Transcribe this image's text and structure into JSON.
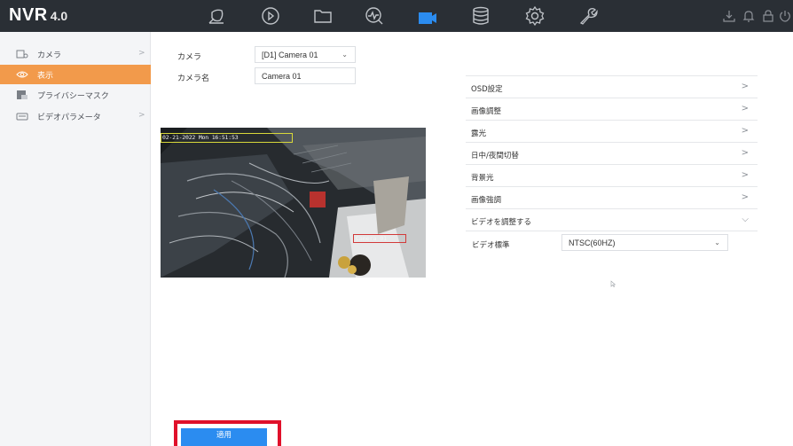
{
  "app": {
    "brand": "NVR",
    "version": "4.0"
  },
  "topnav": {
    "items": [
      {
        "name": "live-view",
        "icon": "live-view-icon"
      },
      {
        "name": "playback",
        "icon": "playback-icon"
      },
      {
        "name": "file-management",
        "icon": "folder-icon"
      },
      {
        "name": "smart-analysis",
        "icon": "analysis-icon"
      },
      {
        "name": "camera",
        "icon": "camera-icon",
        "active": true
      },
      {
        "name": "storage",
        "icon": "storage-icon"
      },
      {
        "name": "configuration",
        "icon": "gear-icon"
      },
      {
        "name": "maintenance",
        "icon": "wrench-icon"
      }
    ],
    "utilities": [
      "download-icon",
      "bell-icon",
      "lock-icon",
      "power-icon"
    ],
    "active_color": "#2b8cf0"
  },
  "sidebar": {
    "items": [
      {
        "label": "カメラ",
        "icon": "camera-icon",
        "has_children": true
      },
      {
        "label": "表示",
        "icon": "eye-icon",
        "active": true
      },
      {
        "label": "プライバシーマスク",
        "icon": "privacy-mask-icon"
      },
      {
        "label": "ビデオパラメータ",
        "icon": "video-parameter-icon",
        "has_children": true
      }
    ],
    "chevron": ">",
    "active_color": "#f29a4b"
  },
  "form": {
    "camera_label": "カメラ",
    "camera_value": "[D1] Camera 01",
    "camera_name_label": "カメラ名",
    "camera_name_value": "Camera 01"
  },
  "preview": {
    "osd_datetime": "02-21-2022 Mon 16:51:53",
    "osd_camera_name": "Camera 01"
  },
  "settings": {
    "rows": [
      {
        "label": "OSD設定",
        "chevron": ">"
      },
      {
        "label": "画像調整",
        "chevron": ">"
      },
      {
        "label": "露光",
        "chevron": ">"
      },
      {
        "label": "日中/夜間切替",
        "chevron": ">"
      },
      {
        "label": "背景光",
        "chevron": ">"
      },
      {
        "label": "画像強調",
        "chevron": ">"
      },
      {
        "label": "ビデオを調整する",
        "chevron": "⌵",
        "expanded": true
      }
    ],
    "video_standard_label": "ビデオ標準",
    "video_standard_value": "NTSC(60HZ)"
  },
  "footer": {
    "apply_label": "適用",
    "highlight_color": "#e0102a"
  }
}
